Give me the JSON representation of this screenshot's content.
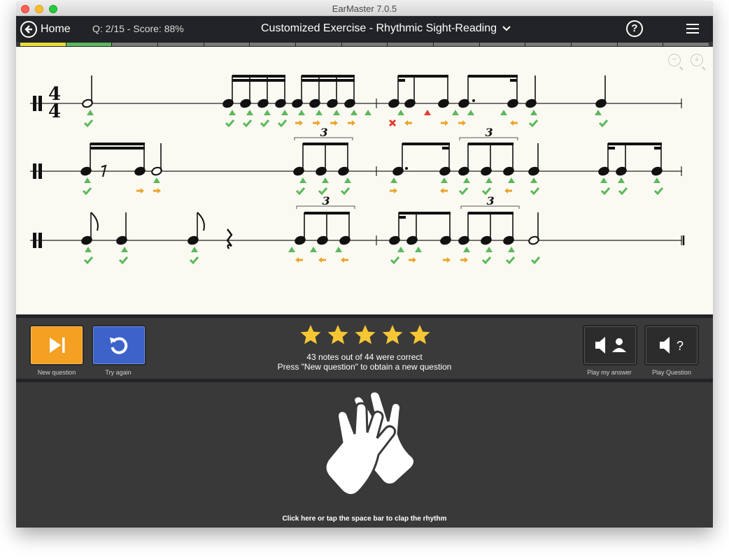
{
  "window": {
    "title": "EarMaster 7.0.5"
  },
  "appbar": {
    "home_label": "Home",
    "question_score": "Q: 2/15 - Score: 88%",
    "exercise_title": "Customized Exercise - Rhythmic Sight-Reading"
  },
  "progress": {
    "total_segments": 15,
    "completed": [
      {
        "index": 0,
        "color": "#e8dc3a"
      },
      {
        "index": 1,
        "color": "#5cb85c"
      }
    ]
  },
  "score": {
    "time_signature": {
      "top": "4",
      "bottom": "4"
    },
    "tuplet_label": "3",
    "colors": {
      "ok": "#5cb85c",
      "early_late": "#e8a52c",
      "error": "#e03c31"
    }
  },
  "controls": {
    "new_question_label": "New question",
    "try_again_label": "Try again",
    "play_my_answer_label": "Play my answer",
    "play_question_label": "Play Question",
    "play_question_glyph": "?",
    "stars": 5,
    "result_line1": "43 notes out of 44 were correct",
    "result_line2": "Press \"New question\" to obtain a new question"
  },
  "clap": {
    "label": "Click here or tap the space bar to clap the rhythm"
  }
}
